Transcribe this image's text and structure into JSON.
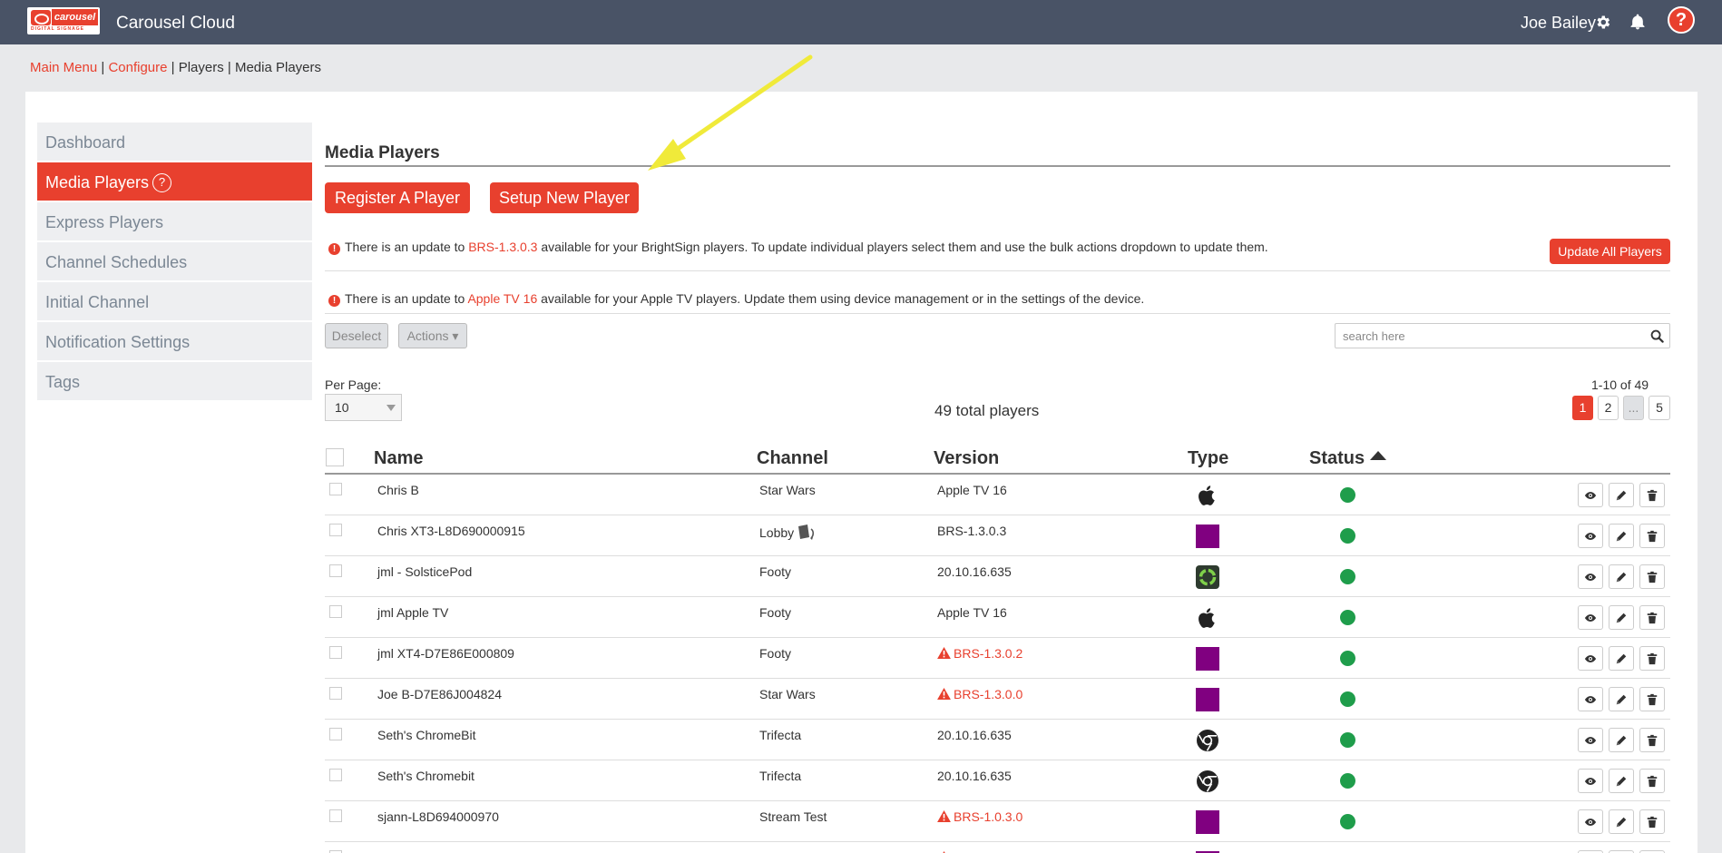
{
  "header": {
    "logo_word": "carousel",
    "logo_tag": "DIGITAL SIGNAGE",
    "app_title": "Carousel Cloud",
    "user_name": "Joe Bailey",
    "help_label": "?"
  },
  "breadcrumb": {
    "main_menu": "Main Menu",
    "sep1": " | ",
    "configure": "Configure",
    "rest": " | Players | Media Players"
  },
  "sidebar": {
    "items": [
      {
        "label": "Dashboard"
      },
      {
        "label": "Media Players",
        "help": "?"
      },
      {
        "label": "Express Players"
      },
      {
        "label": "Channel Schedules"
      },
      {
        "label": "Initial Channel"
      },
      {
        "label": "Notification Settings"
      },
      {
        "label": "Tags"
      }
    ]
  },
  "main": {
    "title": "Media Players",
    "register_label": "Register A Player",
    "setup_label": "Setup New Player",
    "notice1": {
      "before": "There is an update to ",
      "highlight": "BRS-1.3.0.3",
      "after": " available for your BrightSign players. To update individual players select them and use the bulk actions dropdown to update them."
    },
    "update_all_label": "Update All Players",
    "notice2": {
      "before": "There is an update to ",
      "highlight": "Apple TV 16",
      "after": " available for your Apple TV players. Update them using device management or in the settings of the device."
    },
    "deselect_label": "Deselect",
    "actions_label": "Actions ▾",
    "search_placeholder": "search here",
    "per_page_label": "Per Page:",
    "per_page_value": "10",
    "total_text": "49 total players",
    "range_text": "1-10 of 49",
    "pages": [
      "1",
      "2",
      "...",
      "5"
    ]
  },
  "table": {
    "headers": {
      "name": "Name",
      "channel": "Channel",
      "version": "Version",
      "type": "Type",
      "status": "Status"
    },
    "rows": [
      {
        "name": "Chris B",
        "channel": "Star Wars",
        "version": "Apple TV 16",
        "warn": false,
        "type": "apple"
      },
      {
        "name": "Chris XT3-L8D690000915",
        "channel": "Lobby",
        "version": "BRS-1.3.0.3",
        "warn": false,
        "type": "brightsign",
        "channel_icon": true
      },
      {
        "name": "jml - SolsticePod",
        "channel": "Footy",
        "version": "20.10.16.635",
        "warn": false,
        "type": "solstice"
      },
      {
        "name": "jml Apple TV",
        "channel": "Footy",
        "version": "Apple TV 16",
        "warn": false,
        "type": "apple"
      },
      {
        "name": "jml XT4-D7E86E000809",
        "channel": "Footy",
        "version": "BRS-1.3.0.2",
        "warn": true,
        "type": "brightsign"
      },
      {
        "name": "Joe B-D7E86J004824",
        "channel": "Star Wars",
        "version": "BRS-1.3.0.0",
        "warn": true,
        "type": "brightsign"
      },
      {
        "name": "Seth's ChromeBit",
        "channel": "Trifecta",
        "version": "20.10.16.635",
        "warn": false,
        "type": "chrome"
      },
      {
        "name": "Seth's Chromebit",
        "channel": "Trifecta",
        "version": "20.10.16.635",
        "warn": false,
        "type": "chrome"
      },
      {
        "name": "sjann-L8D694000970",
        "channel": "Stream Test",
        "version": "BRS-1.0.3.0",
        "warn": true,
        "type": "brightsign"
      },
      {
        "name": "",
        "channel": "",
        "version": "",
        "warn": true,
        "type": "brightsign"
      }
    ]
  },
  "colors": {
    "topbar": "#495366",
    "accent": "#e8402e",
    "status_online": "#1f9d4b",
    "brightsign_type": "#800080",
    "annotation_arrow": "#f0ea3a"
  }
}
